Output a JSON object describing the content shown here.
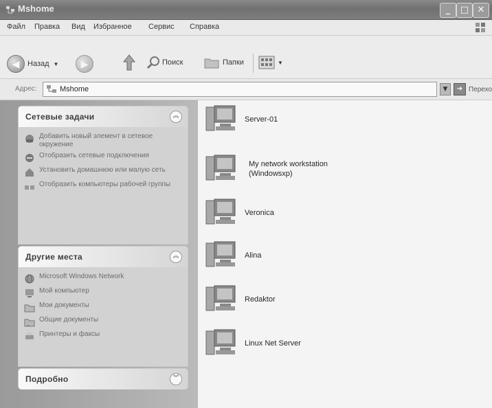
{
  "window": {
    "title": "Mshome"
  },
  "menu": [
    "Файл",
    "Правка",
    "Вид",
    "Избранное",
    "Сервис",
    "Справка"
  ],
  "toolbar": {
    "back_label": "Назад",
    "search_label": "Поиск",
    "folders_label": "Папки"
  },
  "address": {
    "label": "Адрес:",
    "value": "Mshome",
    "go_label": "Переход"
  },
  "sidebar": {
    "network_tasks": {
      "title": "Сетевые задачи",
      "items": [
        "Добавить новый элемент в сетевое окружение",
        "Отобразить сетевые подключения",
        "Установить домашнюю или малую сеть",
        "Отобразить компьютеры рабочей группы"
      ]
    },
    "other_places": {
      "title": "Другие места",
      "items": [
        "Microsoft Windows Network",
        "Мой компьютер",
        "Мои документы",
        "Общие документы",
        "Принтеры и факсы"
      ]
    },
    "details": {
      "title": "Подробно"
    }
  },
  "computers": [
    {
      "name": "Server-01"
    },
    {
      "name": "My network workstation",
      "subtitle": "(Windowsxp)"
    },
    {
      "name": "Veronica"
    },
    {
      "name": "Alina"
    },
    {
      "name": "Redaktor"
    },
    {
      "name": "Linux Net Server"
    }
  ]
}
